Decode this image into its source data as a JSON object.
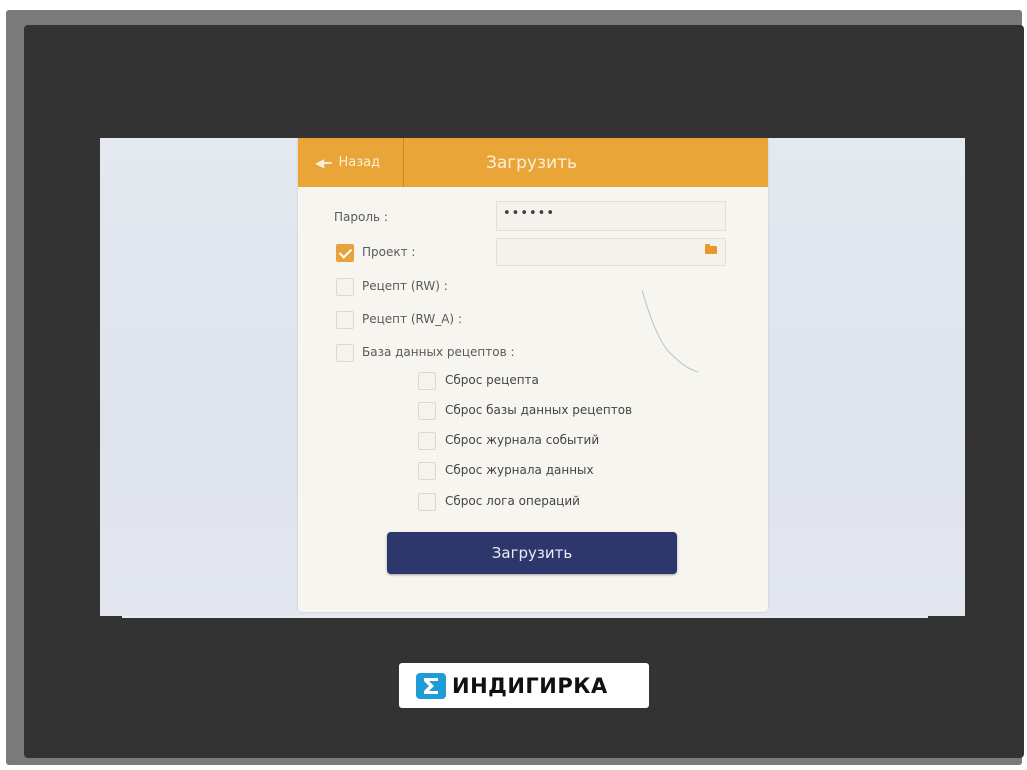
{
  "header": {
    "back_label": "Назад",
    "title": "Загрузить"
  },
  "form": {
    "password": {
      "label": "Пароль :",
      "value": "••••••"
    },
    "project": {
      "label": "Проект :",
      "checked": true
    },
    "recipe_rw": {
      "label": "Рецепт (RW) :",
      "checked": false
    },
    "recipe_rw_a": {
      "label": "Рецепт (RW_A) :",
      "checked": false
    },
    "recipe_db": {
      "label": "База данных рецептов :",
      "checked": false
    },
    "options": [
      {
        "label": "Сброс рецепта",
        "checked": false
      },
      {
        "label": "Сброс базы данных рецептов",
        "checked": false
      },
      {
        "label": "Сброс журнала событий",
        "checked": false
      },
      {
        "label": "Сброс журнала данных",
        "checked": false
      },
      {
        "label": "Сброс лога операций",
        "checked": false
      }
    ],
    "submit_label": "Загрузить"
  },
  "icons": {
    "back": "arrow-left-icon",
    "folder": "folder-icon",
    "logo": "sigma-icon"
  },
  "colors": {
    "header": "#eaa539",
    "accent": "#e9a23a",
    "button": "#2e376b",
    "bezel": "#333333",
    "logo_mark": "#1f9bd6"
  },
  "watermark": {
    "brand": "ИНДИГИРКА"
  }
}
